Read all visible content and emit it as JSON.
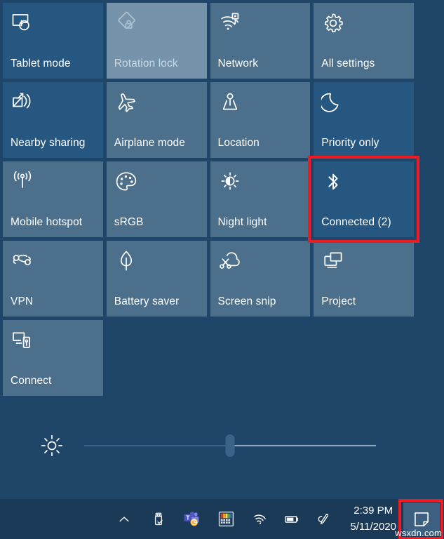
{
  "colors": {
    "background": "#1f4568",
    "tile_on": "#4c6f8c",
    "tile_off": "#255780",
    "tile_disabled": "#7594ac",
    "taskbar": "#1b3a57",
    "highlight": "#ee1b24",
    "text": "#ffffff"
  },
  "quick_actions": {
    "tiles": [
      {
        "label": "Tablet mode",
        "icon": "tablet-mode-icon",
        "state": "off"
      },
      {
        "label": "Rotation lock",
        "icon": "rotation-lock-icon",
        "state": "disabled"
      },
      {
        "label": "Network",
        "icon": "network-icon",
        "state": "on"
      },
      {
        "label": "All settings",
        "icon": "gear-icon",
        "state": "on"
      },
      {
        "label": "Nearby sharing",
        "icon": "nearby-sharing-icon",
        "state": "off"
      },
      {
        "label": "Airplane mode",
        "icon": "airplane-icon",
        "state": "on"
      },
      {
        "label": "Location",
        "icon": "location-icon",
        "state": "on"
      },
      {
        "label": "Priority only",
        "icon": "moon-icon",
        "state": "off"
      },
      {
        "label": "Mobile hotspot",
        "icon": "mobile-hotspot-icon",
        "state": "on"
      },
      {
        "label": "sRGB",
        "icon": "palette-icon",
        "state": "on"
      },
      {
        "label": "Night light",
        "icon": "night-light-icon",
        "state": "on"
      },
      {
        "label": "Connected (2)",
        "icon": "bluetooth-icon",
        "state": "off",
        "highlighted": true
      },
      {
        "label": "VPN",
        "icon": "vpn-icon",
        "state": "on"
      },
      {
        "label": "Battery saver",
        "icon": "leaf-icon",
        "state": "on"
      },
      {
        "label": "Screen snip",
        "icon": "screen-snip-icon",
        "state": "on"
      },
      {
        "label": "Project",
        "icon": "project-icon",
        "state": "on"
      },
      {
        "label": "Connect",
        "icon": "connect-icon",
        "state": "on"
      }
    ]
  },
  "brightness": {
    "icon": "brightness-icon",
    "value": 50,
    "min": 0,
    "max": 100
  },
  "taskbar": {
    "tray_icons": [
      {
        "name": "show-hidden-icons-chevron-icon"
      },
      {
        "name": "usb-safely-remove-icon"
      },
      {
        "name": "microsoft-teams-icon"
      },
      {
        "name": "color-settings-icon"
      },
      {
        "name": "wifi-icon"
      },
      {
        "name": "battery-icon"
      },
      {
        "name": "pen-workspace-icon"
      }
    ],
    "clock": {
      "time": "2:39 PM",
      "date": "5/11/2020"
    },
    "action_center": {
      "icon": "action-center-icon",
      "highlighted": true
    }
  },
  "watermark": {
    "text": "wsxdn.com"
  }
}
